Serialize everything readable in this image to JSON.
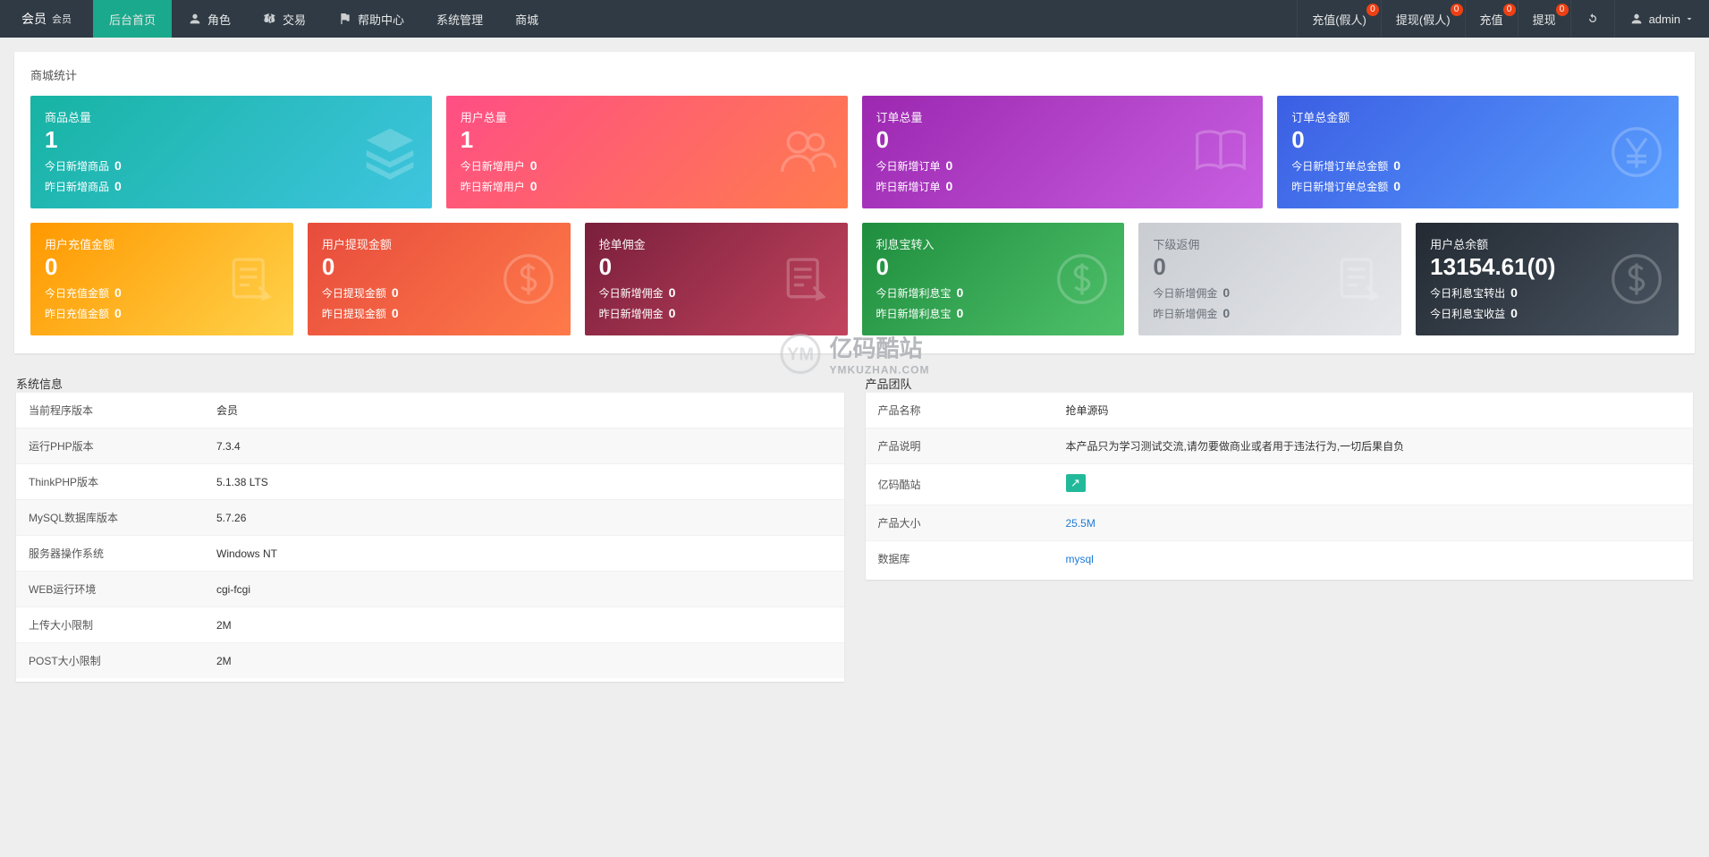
{
  "brand": {
    "name": "会员",
    "sub": "会员"
  },
  "nav": [
    {
      "label": "后台首页",
      "icon": "",
      "active": true
    },
    {
      "label": "角色",
      "icon": "user"
    },
    {
      "label": "交易",
      "icon": "scale"
    },
    {
      "label": "帮助中心",
      "icon": "flag"
    },
    {
      "label": "系统管理",
      "icon": ""
    },
    {
      "label": "商城",
      "icon": ""
    }
  ],
  "topright": {
    "items": [
      {
        "label": "充值(假人)",
        "badge": "0"
      },
      {
        "label": "提现(假人)",
        "badge": "0"
      },
      {
        "label": "充值",
        "badge": "0"
      },
      {
        "label": "提现",
        "badge": "0"
      }
    ],
    "refresh_title": "刷新",
    "user": "admin"
  },
  "stats_title": "商城统计",
  "stat4": [
    {
      "title": "商品总量",
      "big": "1",
      "l1": "今日新增商品",
      "v1": "0",
      "l2": "昨日新增商品",
      "v2": "0",
      "cls": "g-teal",
      "icon": "stack"
    },
    {
      "title": "用户总量",
      "big": "1",
      "l1": "今日新增用户",
      "v1": "0",
      "l2": "昨日新增用户",
      "v2": "0",
      "cls": "g-pink",
      "icon": "users"
    },
    {
      "title": "订单总量",
      "big": "0",
      "l1": "今日新增订单",
      "v1": "0",
      "l2": "昨日新增订单",
      "v2": "0",
      "cls": "g-purple",
      "icon": "book"
    },
    {
      "title": "订单总金额",
      "big": "0",
      "l1": "今日新增订单总金额",
      "v1": "0",
      "l2": "昨日新增订单总金额",
      "v2": "0",
      "cls": "g-blue",
      "icon": "yen"
    }
  ],
  "stat6": [
    {
      "title": "用户充值金额",
      "big": "0",
      "l1": "今日充值金额",
      "v1": "0",
      "l2": "昨日充值金额",
      "v2": "0",
      "cls": "g-orange",
      "icon": "note"
    },
    {
      "title": "用户提现金额",
      "big": "0",
      "l1": "今日提现金额",
      "v1": "0",
      "l2": "昨日提现金额",
      "v2": "0",
      "cls": "g-red",
      "icon": "dollar"
    },
    {
      "title": "抢单佣金",
      "big": "0",
      "l1": "今日新增佣金",
      "v1": "0",
      "l2": "昨日新增佣金",
      "v2": "0",
      "cls": "g-maroon",
      "icon": "note"
    },
    {
      "title": "利息宝转入",
      "big": "0",
      "l1": "今日新增利息宝",
      "v1": "0",
      "l2": "昨日新增利息宝",
      "v2": "0",
      "cls": "g-green",
      "icon": "dollar"
    },
    {
      "title": "下级返佣",
      "big": "0",
      "l1": "今日新增佣金",
      "v1": "0",
      "l2": "昨日新增佣金",
      "v2": "0",
      "cls": "g-grey",
      "icon": "note"
    },
    {
      "title": "用户总余额",
      "big": "13154.61(0)",
      "l1": "今日利息宝转出",
      "v1": "0",
      "l2": "今日利息宝收益",
      "v2": "0",
      "cls": "g-dark",
      "icon": "dollar"
    }
  ],
  "sysinfo": {
    "title": "系统信息",
    "rows": [
      {
        "k": "当前程序版本",
        "v": "会员"
      },
      {
        "k": "运行PHP版本",
        "v": "7.3.4"
      },
      {
        "k": "ThinkPHP版本",
        "v": "5.1.38 LTS"
      },
      {
        "k": "MySQL数据库版本",
        "v": "5.7.26"
      },
      {
        "k": "服务器操作系统",
        "v": "Windows NT"
      },
      {
        "k": "WEB运行环境",
        "v": "cgi-fcgi"
      },
      {
        "k": "上传大小限制",
        "v": "2M"
      },
      {
        "k": "POST大小限制",
        "v": "2M"
      }
    ]
  },
  "team": {
    "title": "产品团队",
    "rows": [
      {
        "k": "产品名称",
        "v": "抢单源码",
        "link": false
      },
      {
        "k": "产品说明",
        "v": "本产品只为学习测试交流,请勿要做商业或者用于违法行为,一切后果自负",
        "link": false
      },
      {
        "k": "亿码酷站",
        "v": "__badge__",
        "link": false
      },
      {
        "k": "产品大小",
        "v": "25.5M",
        "link": true
      },
      {
        "k": "数据库",
        "v": "mysql",
        "link": true
      }
    ]
  },
  "watermark": {
    "zh": "亿码酷站",
    "en": "YMKUZHAN.COM"
  }
}
